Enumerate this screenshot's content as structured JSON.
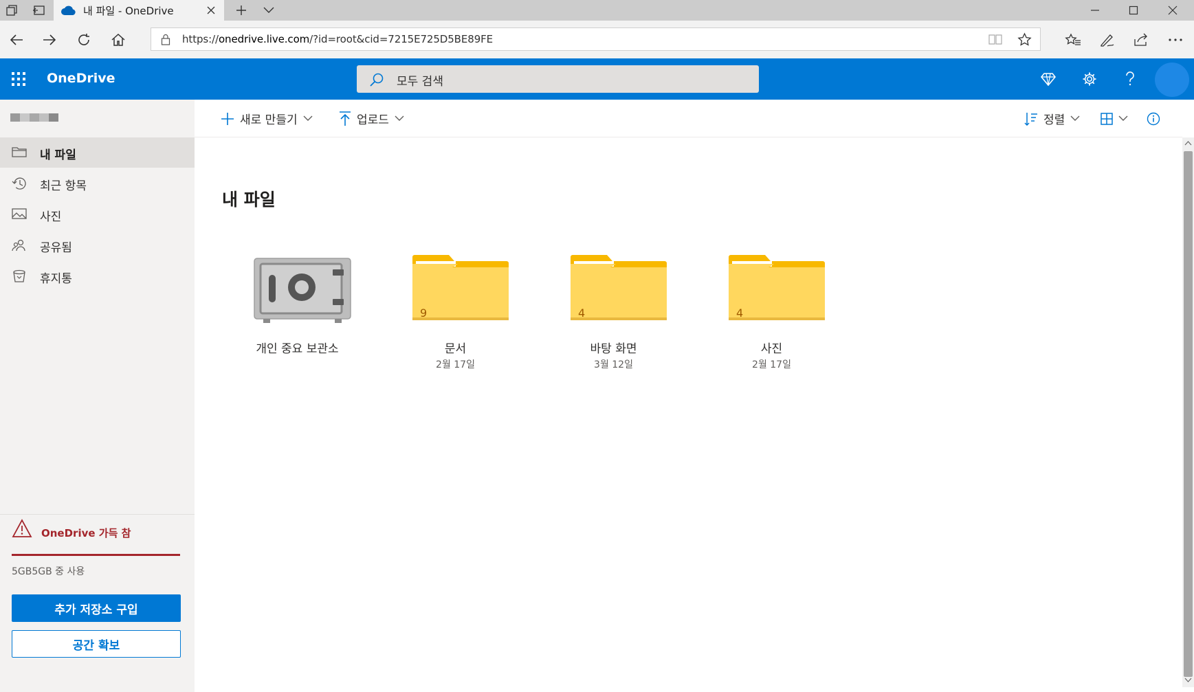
{
  "browser": {
    "tab_title": "내 파일 - OneDrive",
    "url_prefix": "https://",
    "url_host": "onedrive.live.com",
    "url_path": "/?id=root&cid=7215E725D5BE89FE"
  },
  "header": {
    "brand": "OneDrive",
    "search_placeholder": "모두 검색"
  },
  "commandbar": {
    "new_label": "새로 만들기",
    "upload_label": "업로드",
    "sort_label": "정렬"
  },
  "sidebar": {
    "items": [
      {
        "label": "내 파일",
        "icon": "folder-icon",
        "active": true
      },
      {
        "label": "최근 항목",
        "icon": "history-icon",
        "active": false
      },
      {
        "label": "사진",
        "icon": "image-icon",
        "active": false
      },
      {
        "label": "공유됨",
        "icon": "people-icon",
        "active": false
      },
      {
        "label": "휴지통",
        "icon": "recycle-bin-icon",
        "active": false
      }
    ],
    "storage_warning": "OneDrive 가득 참",
    "storage_usage": "5GB5GB 중 사용",
    "buy_storage_label": "추가 저장소 구입",
    "free_space_label": "공간 확보"
  },
  "main": {
    "title": "내 파일",
    "items": [
      {
        "name": "개인 중요 보관소",
        "type": "vault",
        "date": "",
        "count": ""
      },
      {
        "name": "문서",
        "type": "folder",
        "date": "2월 17일",
        "count": "9"
      },
      {
        "name": "바탕 화면",
        "type": "folder",
        "date": "3월 12일",
        "count": "4"
      },
      {
        "name": "사진",
        "type": "folder",
        "date": "2월 17일",
        "count": "4"
      }
    ]
  },
  "colors": {
    "brand_blue": "#0078d4",
    "warning_red": "#a4262c",
    "folder_yellow": "#ffd75e",
    "folder_tab": "#f8b800"
  }
}
